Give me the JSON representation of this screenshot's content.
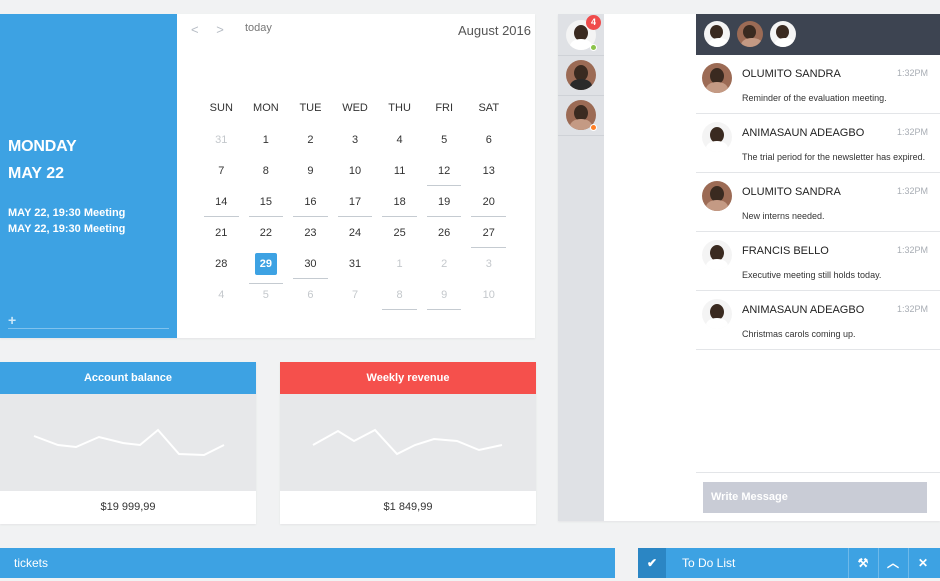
{
  "calendar": {
    "side": {
      "weekday": "MONDAY",
      "date": "MAY 22",
      "events": [
        "MAY 22, 19:30 Meeting",
        "MAY 22, 19:30 Meeting"
      ],
      "add": "+"
    },
    "nav": {
      "prev": "<",
      "next": ">",
      "today": "today"
    },
    "month": "August 2016",
    "weekdays": [
      "SUN",
      "MON",
      "TUE",
      "WED",
      "THU",
      "FRI",
      "SAT"
    ],
    "weeks": [
      [
        "31",
        "1",
        "2",
        "3",
        "4",
        "5",
        "6"
      ],
      [
        "7",
        "8",
        "9",
        "10",
        "11",
        "12",
        "13"
      ],
      [
        "14",
        "15",
        "16",
        "17",
        "18",
        "19",
        "20"
      ],
      [
        "21",
        "22",
        "23",
        "24",
        "25",
        "26",
        "27"
      ],
      [
        "28",
        "29",
        "30",
        "31",
        "1",
        "2",
        "3"
      ],
      [
        "4",
        "5",
        "6",
        "7",
        "8",
        "9",
        "10"
      ]
    ],
    "selected_day": "29"
  },
  "stats": {
    "account": {
      "title": "Account balance",
      "value": "$19 999,99",
      "color": "#3da2e3"
    },
    "revenue": {
      "title": "Weekly revenue",
      "value": "$1 849,99",
      "color": "#f5504c"
    }
  },
  "chat": {
    "contacts": [
      {
        "badge": "4",
        "status": "online",
        "status_color": "#8bc34a"
      },
      {
        "status": "none"
      },
      {
        "status": "away",
        "status_color": "#ff7f27"
      }
    ],
    "messages": [
      {
        "name": "OLUMITO SANDRA",
        "time": "1:32PM",
        "text": "Reminder of the evaluation meeting."
      },
      {
        "name": "ANIMASAUN ADEAGBO",
        "time": "1:32PM",
        "text": "The trial period for the newsletter has expired."
      },
      {
        "name": "OLUMITO SANDRA",
        "time": "1:32PM",
        "text": "New interns needed."
      },
      {
        "name": "FRANCIS BELLO",
        "time": "1:32PM",
        "text": "Executive meeting still holds today."
      },
      {
        "name": "ANIMASAUN ADEAGBO",
        "time": "1:32PM",
        "text": "Christmas carols coming up."
      }
    ],
    "input_placeholder": "Write Message"
  },
  "tickets": {
    "title": "tickets"
  },
  "todo": {
    "title": "To Do List",
    "icons": [
      "check-icon",
      "wrench-icon",
      "chevron-up-icon",
      "close-icon"
    ]
  }
}
